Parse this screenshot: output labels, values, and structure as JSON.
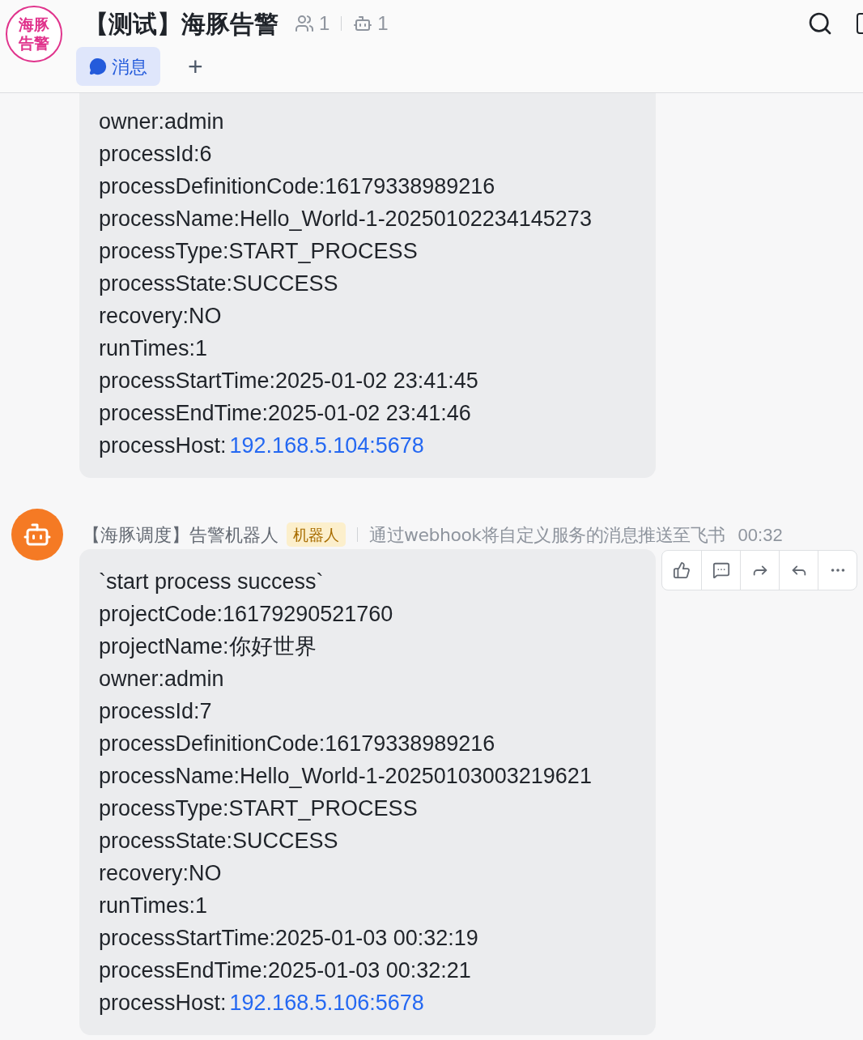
{
  "chat": {
    "logo_lines": [
      "海豚",
      "告警"
    ],
    "title": "【测试】海豚告警",
    "member_count": "1",
    "bot_count": "1"
  },
  "tabs": [
    {
      "label": "消息",
      "selected": true,
      "kind": "messages"
    },
    {
      "label": "+",
      "selected": false,
      "kind": "add"
    }
  ],
  "messages": [
    {
      "lines": [
        {
          "kind": "text",
          "text": "owner:admin"
        },
        {
          "kind": "text",
          "text": "processId:6"
        },
        {
          "kind": "text",
          "text": "processDefinitionCode:16179338989216"
        },
        {
          "kind": "text",
          "text": "processName:Hello_World-1-20250102234145273"
        },
        {
          "kind": "text",
          "text": "processType:START_PROCESS"
        },
        {
          "kind": "text",
          "text": "processState:SUCCESS"
        },
        {
          "kind": "text",
          "text": "recovery:NO"
        },
        {
          "kind": "text",
          "text": "runTimes:1"
        },
        {
          "kind": "text",
          "text": "processStartTime:2025-01-02 23:41:45"
        },
        {
          "kind": "text",
          "text": "processEndTime:2025-01-02 23:41:46"
        },
        {
          "kind": "link",
          "text": "processHost:",
          "link": "192.168.5.104:5678"
        }
      ]
    },
    {
      "sender": "【海豚调度】告警机器人",
      "badge": "机器人",
      "description": "通过webhook将自定义服务的消息推送至飞书",
      "time": "00:32",
      "lines": [
        {
          "kind": "text",
          "text": "`start process success`"
        },
        {
          "kind": "text",
          "text": "projectCode:16179290521760"
        },
        {
          "kind": "text",
          "text": "projectName:你好世界"
        },
        {
          "kind": "text",
          "text": "owner:admin"
        },
        {
          "kind": "text",
          "text": "processId:7"
        },
        {
          "kind": "text",
          "text": "processDefinitionCode:16179338989216"
        },
        {
          "kind": "text",
          "text": "processName:Hello_World-1-20250103003219621"
        },
        {
          "kind": "text",
          "text": "processType:START_PROCESS"
        },
        {
          "kind": "text",
          "text": "processState:SUCCESS"
        },
        {
          "kind": "text",
          "text": "recovery:NO"
        },
        {
          "kind": "text",
          "text": "runTimes:1"
        },
        {
          "kind": "text",
          "text": "processStartTime:2025-01-03 00:32:19"
        },
        {
          "kind": "text",
          "text": "processEndTime:2025-01-03 00:32:21"
        },
        {
          "kind": "link",
          "text": "processHost:",
          "link": "192.168.5.106:5678"
        }
      ]
    }
  ]
}
